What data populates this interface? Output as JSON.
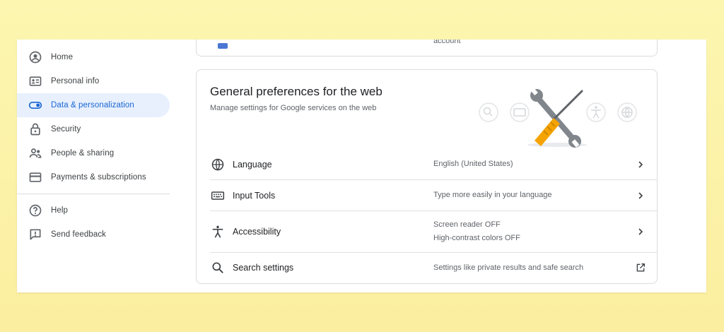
{
  "sidebar": {
    "items": [
      {
        "label": "Home",
        "icon": "account-circle-icon"
      },
      {
        "label": "Personal info",
        "icon": "id-card-icon"
      },
      {
        "label": "Data & personalization",
        "icon": "toggle-icon",
        "active": true
      },
      {
        "label": "Security",
        "icon": "lock-icon"
      },
      {
        "label": "People & sharing",
        "icon": "people-icon"
      },
      {
        "label": "Payments & subscriptions",
        "icon": "credit-card-icon"
      }
    ],
    "footer_items": [
      {
        "label": "Help",
        "icon": "help-icon"
      },
      {
        "label": "Send feedback",
        "icon": "feedback-icon"
      }
    ]
  },
  "top_card": {
    "trailing_text": "account"
  },
  "general_preferences": {
    "title": "General preferences for the web",
    "subtitle": "Manage settings for Google services on the web",
    "rows": [
      {
        "label": "Language",
        "value": "English (United States)",
        "icon": "globe-icon",
        "action": "chevron-right-icon"
      },
      {
        "label": "Input Tools",
        "value": "Type more easily in your language",
        "icon": "keyboard-icon",
        "action": "chevron-right-icon"
      },
      {
        "label": "Accessibility",
        "value_line1": "Screen reader OFF",
        "value_line2": "High-contrast colors OFF",
        "icon": "accessibility-icon",
        "action": "chevron-right-icon"
      },
      {
        "label": "Search settings",
        "value": "Settings like private results and safe search",
        "icon": "search-icon",
        "action": "open-in-new-icon"
      }
    ]
  },
  "colors": {
    "accent": "#1967d2",
    "active_bg": "#e8f0fe",
    "screwdriver": "#f5a300",
    "wrench": "#80868b"
  }
}
